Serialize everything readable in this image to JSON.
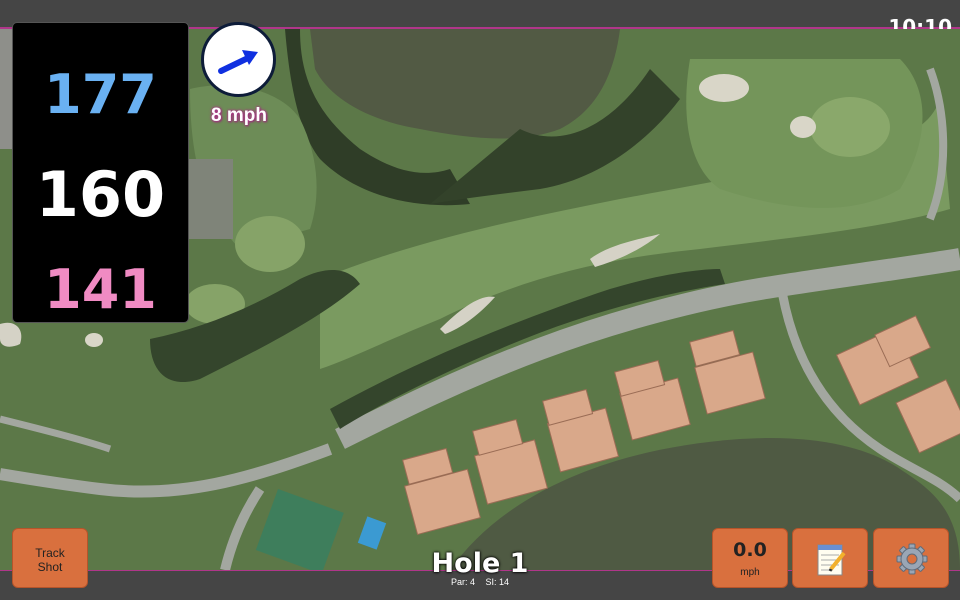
{
  "status": {
    "time": "10:10"
  },
  "distances": {
    "back": "177",
    "middle": "160",
    "front": "141"
  },
  "wind": {
    "speed": "8 mph",
    "icon": "arrow-icon"
  },
  "buttons": {
    "track_shot": {
      "line1": "Track",
      "line2": "Shot"
    },
    "speed": {
      "value": "0.0",
      "unit": "mph"
    },
    "notes": {
      "icon": "notepad-icon"
    },
    "settings": {
      "icon": "gear-icon"
    }
  },
  "hole": {
    "title": "Hole 1",
    "par": "Par: 4",
    "si": "SI: 14"
  },
  "colors": {
    "back": "#6ab1f2",
    "middle": "#ffffff",
    "front": "#f08bc3",
    "accent": "#b0368a",
    "button": "#d9703e"
  }
}
